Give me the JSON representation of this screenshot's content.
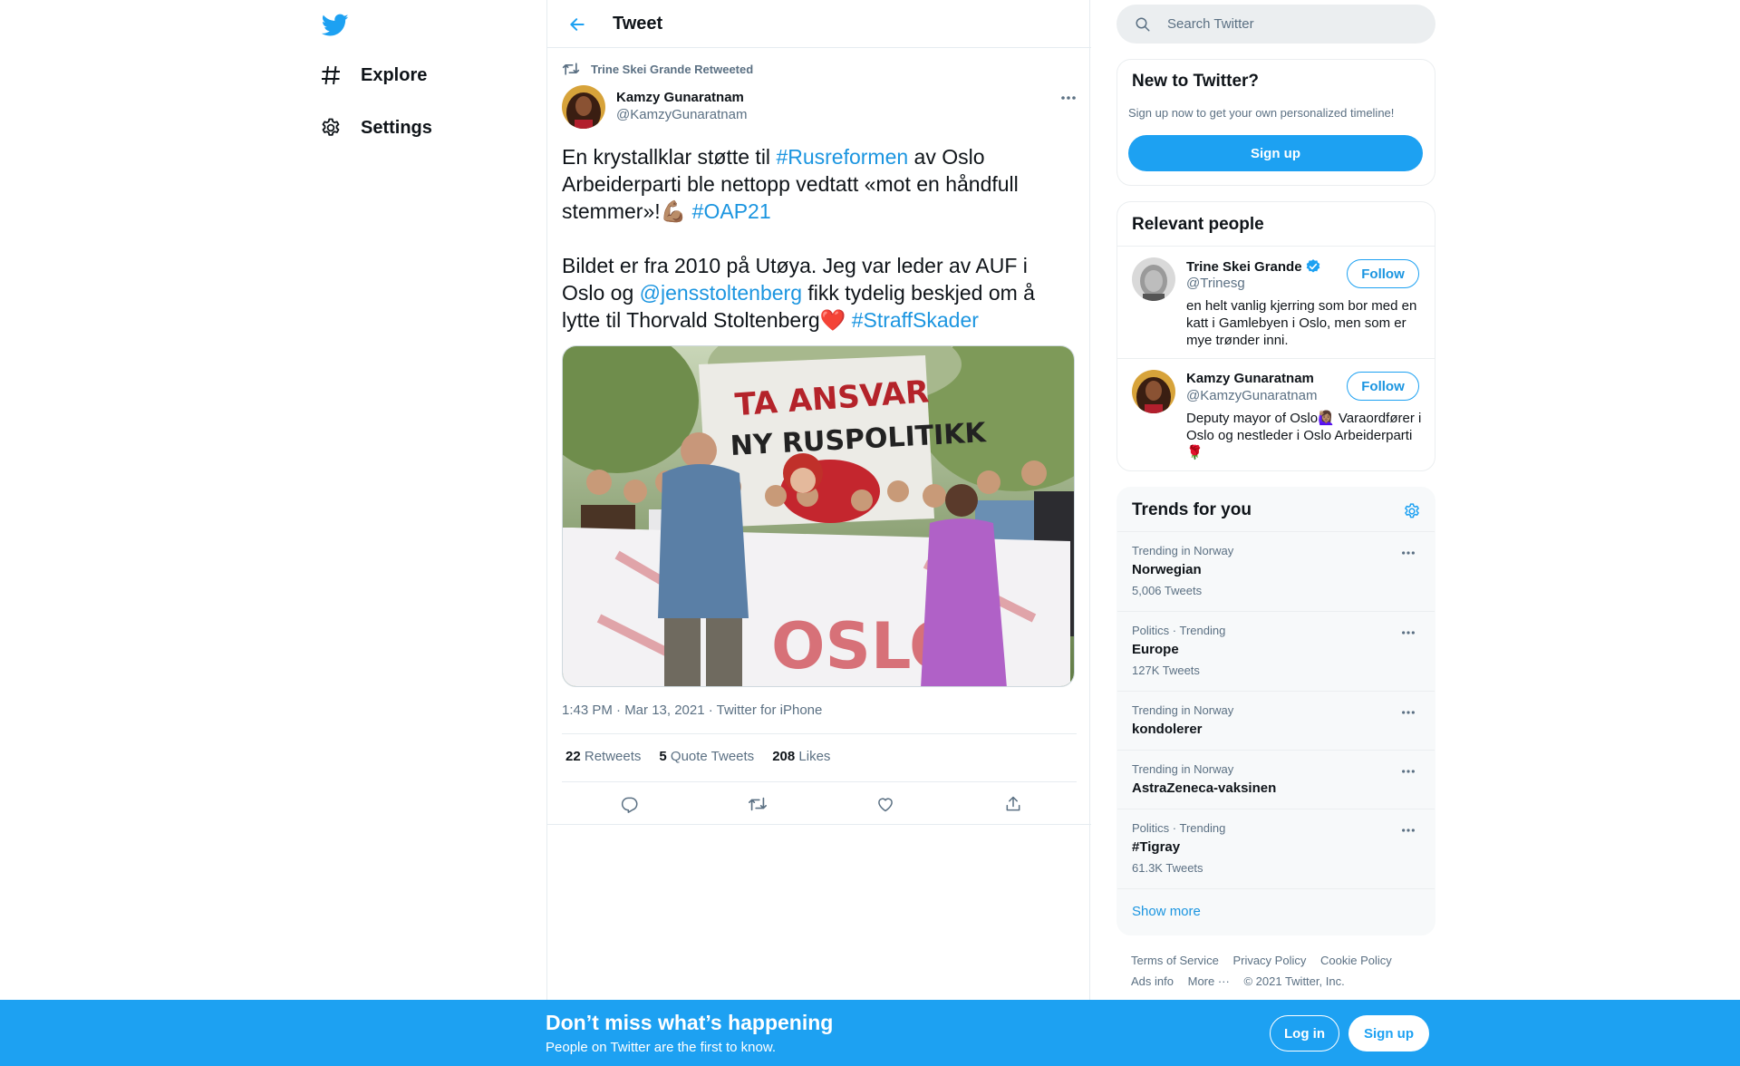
{
  "nav": {
    "logo": "twitter-bird-icon",
    "items": [
      {
        "label": "Explore",
        "icon": "hashtag-icon"
      },
      {
        "label": "Settings",
        "icon": "gear-icon"
      }
    ]
  },
  "header": {
    "title": "Tweet",
    "back_icon": "arrow-left-icon"
  },
  "tweet": {
    "retweeted_by": "Trine Skei Grande Retweeted",
    "author_name": "Kamzy Gunaratnam",
    "author_handle": "@KamzyGunaratnam",
    "text": {
      "p1_a": "En krystallklar støtte til ",
      "p1_tag1": "#Rusreformen",
      "p1_b": " av Oslo Arbeiderparti ble nettopp vedtatt «mot en håndfull stemmer»!",
      "p1_emoji": "💪🏽",
      "p1_tag2": "#OAP21",
      "p2_a": "Bildet er fra 2010 på Utøya. Jeg var leder av AUF i Oslo og ",
      "p2_mention": "@jensstoltenberg",
      "p2_b": " fikk tydelig beskjed om å lytte til Thorvald Stoltenberg",
      "p2_emoji": "❤️",
      "p2_tag": "#StraffSkader"
    },
    "photo_banner_top": "TA ANSVAR NY RUSPOLITIKK",
    "photo_banner_bottom": "OSLO",
    "timestamp": "1:43 PM · Mar 13, 2021 · Twitter for iPhone",
    "stats": [
      {
        "count": "22",
        "label": "Retweets"
      },
      {
        "count": "5",
        "label": "Quote Tweets"
      },
      {
        "count": "208",
        "label": "Likes"
      }
    ]
  },
  "search": {
    "placeholder": "Search Twitter"
  },
  "new_to_twitter": {
    "title": "New to Twitter?",
    "subtitle": "Sign up now to get your own personalized timeline!",
    "button": "Sign up"
  },
  "relevant_people": {
    "title": "Relevant people",
    "people": [
      {
        "name": "Trine Skei Grande",
        "handle": "@Trinesg",
        "verified": true,
        "bio": "en helt vanlig kjerring som bor med en katt i Gamlebyen i Oslo, men som er mye trønder inni.",
        "follow": "Follow"
      },
      {
        "name": "Kamzy Gunaratnam",
        "handle": "@KamzyGunaratnam",
        "verified": false,
        "bio": "Deputy mayor of Oslo🙋🏽‍♀️ Varaordfører i Oslo og nestleder i Oslo Arbeiderparti🌹",
        "follow": "Follow"
      }
    ]
  },
  "trends": {
    "title": "Trends for you",
    "items": [
      {
        "context": "Trending in Norway",
        "name": "Norwegian",
        "count": "5,006 Tweets"
      },
      {
        "context": "Politics · Trending",
        "name": "Europe",
        "count": "127K Tweets"
      },
      {
        "context": "Trending in Norway",
        "name": "kondolerer",
        "count": ""
      },
      {
        "context": "Trending in Norway",
        "name": "AstraZeneca-vaksinen",
        "count": ""
      },
      {
        "context": "Politics · Trending",
        "name": "#Tigray",
        "count": "61.3K Tweets"
      }
    ],
    "show_more": "Show more"
  },
  "footer": {
    "links": [
      "Terms of Service",
      "Privacy Policy",
      "Cookie Policy"
    ],
    "links2": [
      "Ads info",
      "More ···"
    ],
    "copyright": "© 2021 Twitter, Inc."
  },
  "bottom_bar": {
    "headline": "Don’t miss what’s happening",
    "subline": "People on Twitter are the first to know.",
    "login": "Log in",
    "signup": "Sign up"
  },
  "colors": {
    "accent": "#1da1f2",
    "link": "#1b95e0",
    "muted": "#5b7083",
    "border": "#e6ecf0"
  }
}
